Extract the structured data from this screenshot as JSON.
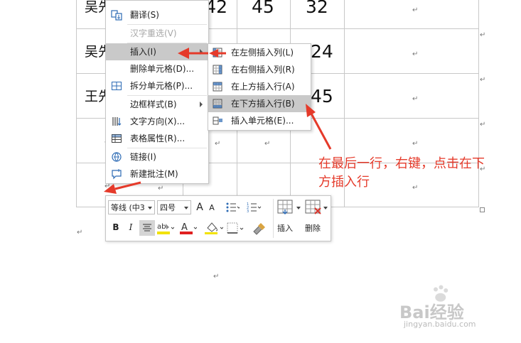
{
  "table": {
    "rows": [
      {
        "name": "吴先",
        "c1": "42",
        "c2": "45",
        "c3": "32"
      },
      {
        "name": "吴先",
        "c1": "",
        "c2": "",
        "c3": "24"
      },
      {
        "name": "王先",
        "c1": "",
        "c2": "",
        "c3": "45"
      },
      {
        "name": "",
        "c1": "",
        "c2": "",
        "c3": ""
      },
      {
        "name": "",
        "c1": "",
        "c2": "",
        "c3": ""
      }
    ],
    "para_mark": "↵"
  },
  "context_menu": {
    "items": [
      {
        "label": "翻译(S)",
        "icon": "translate-icon"
      },
      {
        "label": "汉字重选(V)",
        "icon": "",
        "disabled": true
      },
      {
        "label": "插入(I)",
        "icon": "",
        "highlighted": true,
        "has_submenu": true
      },
      {
        "label": "删除单元格(D)...",
        "icon": ""
      },
      {
        "label": "拆分单元格(P)...",
        "icon": "split-cells-icon"
      },
      {
        "label": "边框样式(B)",
        "icon": "",
        "has_submenu": true
      },
      {
        "label": "文字方向(X)...",
        "icon": "text-direction-icon"
      },
      {
        "label": "表格属性(R)...",
        "icon": "table-properties-icon"
      },
      {
        "label": "链接(I)",
        "icon": "link-icon"
      },
      {
        "label": "新建批注(M)",
        "icon": "new-comment-icon"
      }
    ]
  },
  "submenu": {
    "items": [
      {
        "label": "在左侧插入列(L)",
        "icon": "insert-col-left-icon"
      },
      {
        "label": "在右侧插入列(R)",
        "icon": "insert-col-right-icon"
      },
      {
        "label": "在上方插入行(A)",
        "icon": "insert-row-above-icon"
      },
      {
        "label": "在下方插入行(B)",
        "icon": "insert-row-below-icon",
        "highlighted": true
      },
      {
        "label": "插入单元格(E)...",
        "icon": "insert-cells-icon"
      }
    ]
  },
  "mini_toolbar": {
    "font_name": "等线 (中3",
    "font_size": "四号",
    "grow_font": "A",
    "shrink_font": "A",
    "bold": "B",
    "italic": "I",
    "insert_label": "插入",
    "delete_label": "删除"
  },
  "annotation": {
    "text_line1": "在最后一行，右键，点击在下",
    "text_line2": "方插入行",
    "color": "#e53a2a"
  },
  "watermark": {
    "brand": "Bai经验",
    "url": "jingyan.baidu.com"
  }
}
